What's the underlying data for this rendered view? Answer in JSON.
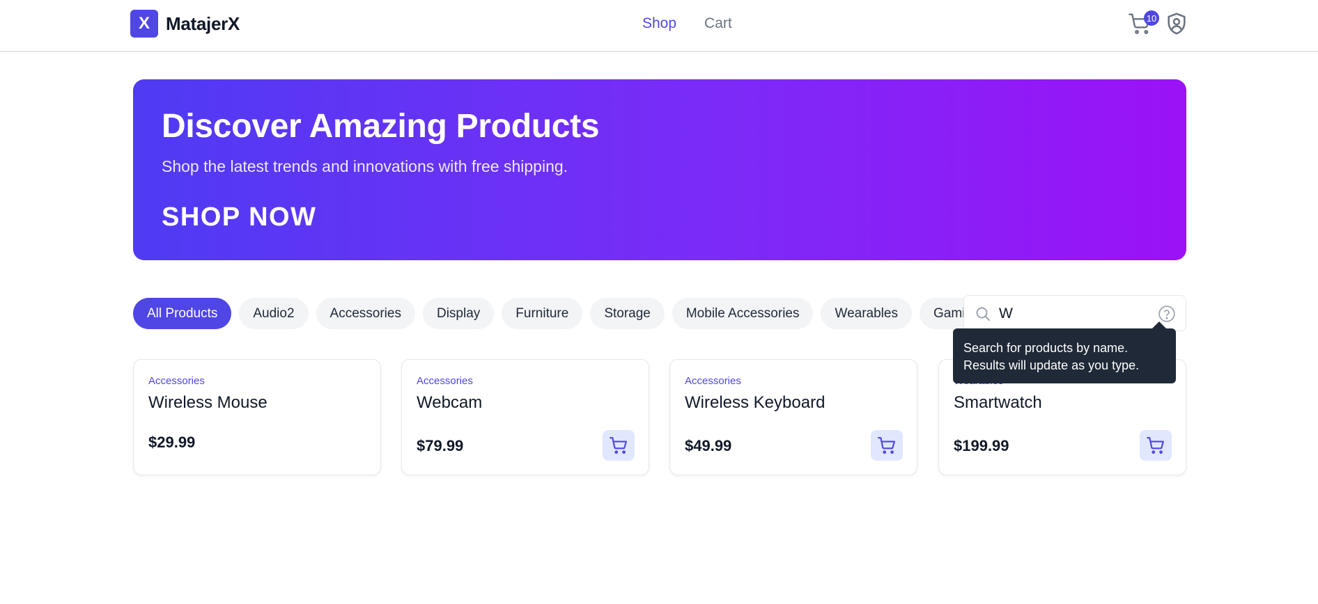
{
  "header": {
    "logo_letter": "X",
    "brand": "MatajerX",
    "nav": [
      {
        "label": "Shop",
        "active": true
      },
      {
        "label": "Cart",
        "active": false
      }
    ],
    "cart_count": "10",
    "icons": {
      "cart": "shopping-cart-icon",
      "account": "shield-user-icon"
    }
  },
  "hero": {
    "title": "Discover Amazing Products",
    "subtitle": "Shop the latest trends and innovations with free shipping.",
    "cta": "SHOP NOW"
  },
  "filters": [
    {
      "label": "All Products",
      "active": true
    },
    {
      "label": "Audio2",
      "active": false
    },
    {
      "label": "Accessories",
      "active": false
    },
    {
      "label": "Display",
      "active": false
    },
    {
      "label": "Furniture",
      "active": false
    },
    {
      "label": "Storage",
      "active": false
    },
    {
      "label": "Mobile Accessories",
      "active": false
    },
    {
      "label": "Wearables",
      "active": false
    },
    {
      "label": "Gaming",
      "active": false
    }
  ],
  "search": {
    "value": "W",
    "tooltip": "Search for products by name. Results will update as you type."
  },
  "products": [
    {
      "category": "Accessories",
      "name": "Wireless Mouse",
      "price": "$29.99",
      "has_cart_button": false
    },
    {
      "category": "Accessories",
      "name": "Webcam",
      "price": "$79.99",
      "has_cart_button": true
    },
    {
      "category": "Accessories",
      "name": "Wireless Keyboard",
      "price": "$49.99",
      "has_cart_button": true
    },
    {
      "category": "Wearables",
      "name": "Smartwatch",
      "price": "$199.99",
      "has_cart_button": true
    }
  ],
  "colors": {
    "accent": "#4f46e5",
    "hero_start": "#4f3bf3",
    "hero_end": "#9b12f7",
    "cta_underline": "#ec4899",
    "tooltip_bg": "#1f2937"
  }
}
